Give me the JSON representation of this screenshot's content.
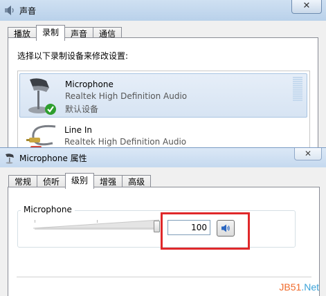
{
  "sound_dialog": {
    "title": "声音",
    "close_label": "✕",
    "tabs": [
      {
        "label": "播放",
        "active": false
      },
      {
        "label": "录制",
        "active": true
      },
      {
        "label": "声音",
        "active": false
      },
      {
        "label": "通信",
        "active": false
      }
    ],
    "instruction": "选择以下录制设备来修改设置:",
    "devices": [
      {
        "name": "Microphone",
        "description": "Realtek High Definition Audio",
        "status": "默认设备",
        "selected": true,
        "icon": "microphone-icon"
      },
      {
        "name": "Line In",
        "description": "Realtek High Definition Audio",
        "status": "",
        "selected": false,
        "icon": "line-in-cable-icon"
      }
    ]
  },
  "properties_dialog": {
    "title": "Microphone 属性",
    "close_label": "✕",
    "tabs": [
      {
        "label": "常规",
        "active": false
      },
      {
        "label": "侦听",
        "active": false
      },
      {
        "label": "级别",
        "active": true
      },
      {
        "label": "增强",
        "active": false
      },
      {
        "label": "高级",
        "active": false
      }
    ],
    "levels": {
      "group_label": "Microphone",
      "volume_value": "100",
      "slider_percent": 100,
      "mute_icon": "speaker-icon"
    }
  },
  "watermark": {
    "part_a": "JB51",
    "part_b": ".Net"
  },
  "colors": {
    "highlight": "#e0282a",
    "accent": "#3a7bd5"
  }
}
